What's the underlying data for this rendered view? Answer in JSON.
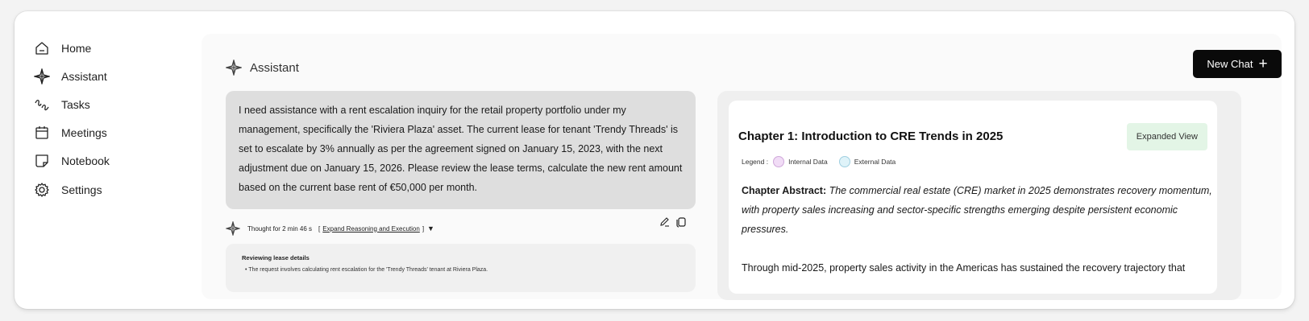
{
  "sidebar": {
    "items": [
      {
        "label": "Home",
        "icon": "home-icon"
      },
      {
        "label": "Assistant",
        "icon": "assistant-icon"
      },
      {
        "label": "Tasks",
        "icon": "tasks-icon"
      },
      {
        "label": "Meetings",
        "icon": "calendar-icon"
      },
      {
        "label": "Notebook",
        "icon": "notebook-icon"
      },
      {
        "label": "Settings",
        "icon": "gear-icon"
      }
    ]
  },
  "header": {
    "title": "Assistant",
    "new_chat_label": "New Chat",
    "new_chat_icon": "plus-icon"
  },
  "chat": {
    "user_message": "I need assistance with a rent escalation inquiry for the retail property portfolio under my management, specifically the 'Riviera Plaza' asset. The current lease for tenant 'Trendy Threads' is set to escalate by 3% annually as per the agreement signed on January 15, 2023, with the next adjustment due on January 15, 2026. Please review the lease terms, calculate the new rent amount based on the current base rent of €50,000 per month.",
    "thought_label": "Thought for 2 min 46 s",
    "expand_open": "[",
    "expand_label": "Expand Reasoning and Execution",
    "expand_close": "]",
    "reasoning_title": "Reviewing lease details",
    "reasoning_bullet": "The request involves calculating rent escalation for the 'Trendy Threads' tenant at Riviera Plaza."
  },
  "document": {
    "title": "Chapter 1: Introduction to CRE Trends in 2025",
    "expanded_view_label": "Expanded View",
    "legend_label": "Legend :",
    "legend_internal": "Internal Data",
    "legend_external": "External Data",
    "abstract_label": "Chapter Abstract:",
    "abstract_text": "The commercial real estate (CRE) market in 2025 demonstrates recovery momentum, with property sales increasing and sector-specific strengths emerging despite persistent economic pressures.",
    "body_text": "Through mid-2025, property sales activity in the Americas has sustained the recovery trajectory that"
  },
  "colors": {
    "new_chat_bg": "#0a0a0a",
    "expanded_view_bg": "#e3f5e6",
    "internal_data": "#f1dcf6",
    "external_data": "#dff3f9",
    "user_bubble": "#dedede"
  }
}
